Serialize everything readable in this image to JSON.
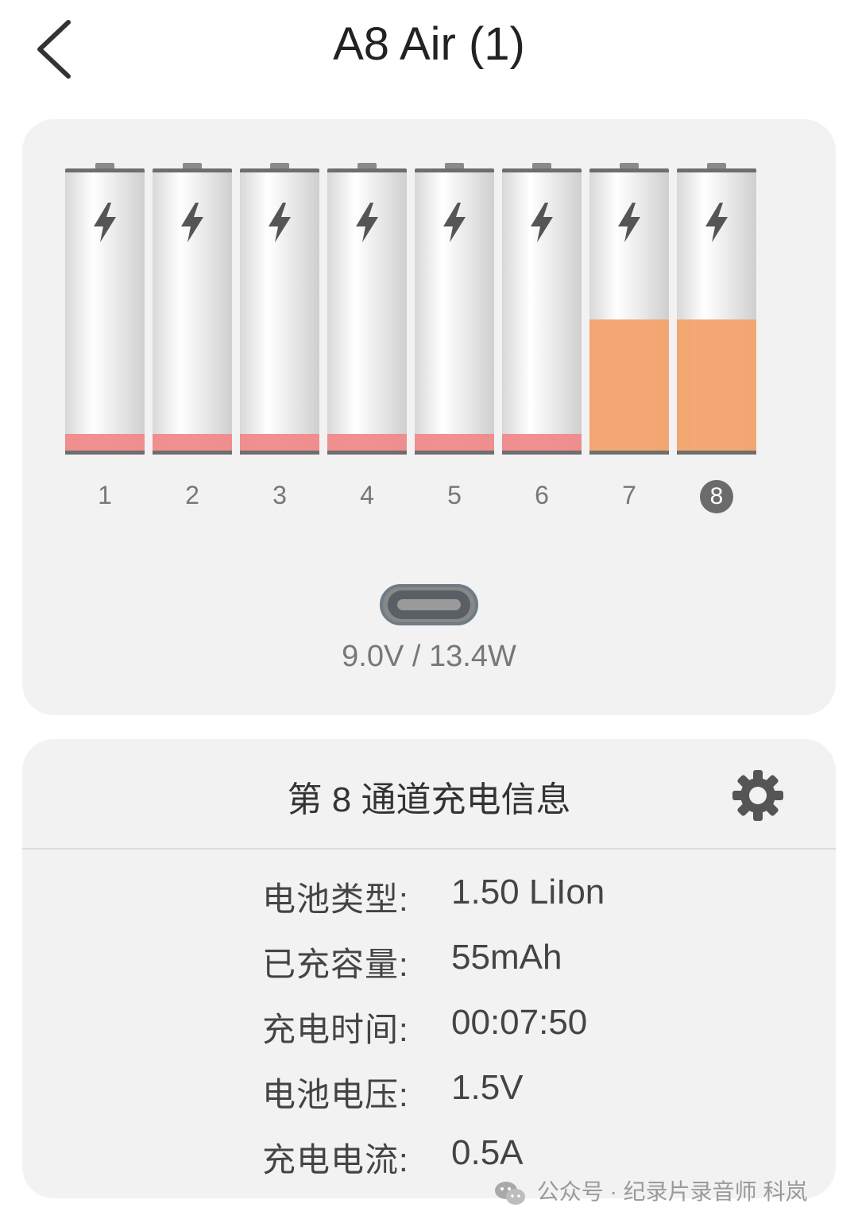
{
  "header": {
    "title": "A8 Air (1)",
    "back_icon": "chevron-left-icon"
  },
  "batteries": [
    {
      "slot": "1",
      "level": 0.06,
      "fill_color": "#f08a8a",
      "active": false
    },
    {
      "slot": "2",
      "level": 0.06,
      "fill_color": "#f08a8a",
      "active": false
    },
    {
      "slot": "3",
      "level": 0.06,
      "fill_color": "#f08a8a",
      "active": false
    },
    {
      "slot": "4",
      "level": 0.06,
      "fill_color": "#f08a8a",
      "active": false
    },
    {
      "slot": "5",
      "level": 0.06,
      "fill_color": "#f08a8a",
      "active": false
    },
    {
      "slot": "6",
      "level": 0.06,
      "fill_color": "#f08a8a",
      "active": false
    },
    {
      "slot": "7",
      "level": 0.47,
      "fill_color": "#f3a46e",
      "active": false
    },
    {
      "slot": "8",
      "level": 0.47,
      "fill_color": "#f3a46e",
      "active": true
    }
  ],
  "power": {
    "readout": "9.0V / 13.4W",
    "icon": "usb-c-port-icon"
  },
  "channel_info": {
    "title": "第 8 通道充电信息",
    "settings_icon": "gear-icon",
    "rows": [
      {
        "label": "电池类型:",
        "value": "1.50 LiIon"
      },
      {
        "label": "已充容量:",
        "value": "55mAh"
      },
      {
        "label": "充电时间:",
        "value": "00:07:50"
      },
      {
        "label": "电池电压:",
        "value": "1.5V"
      },
      {
        "label": "充电电流:",
        "value": "0.5A"
      }
    ]
  },
  "watermark": {
    "text": "公众号 · 纪录片录音师 科岚",
    "icon": "wechat-icon"
  },
  "colors": {
    "card_bg": "#f2f2f2",
    "low_charge": "#f08a8a",
    "mid_charge": "#f3a46e"
  }
}
